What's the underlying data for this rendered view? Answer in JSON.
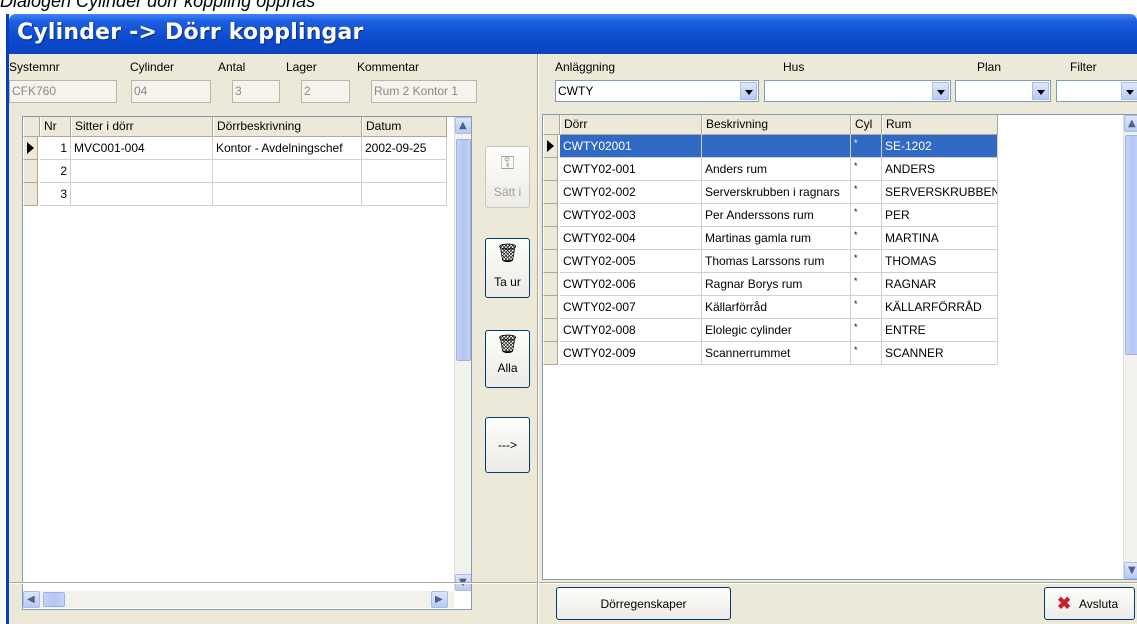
{
  "caption": "Dialogen Cylinder dörr koppling öppnas",
  "window": {
    "title": "Cylinder -> Dörr kopplingar"
  },
  "cylinder_info": {
    "labels": {
      "systemnr": "Systemnr",
      "cylinder": "Cylinder",
      "antal": "Antal",
      "lager": "Lager",
      "kommentar": "Kommentar"
    },
    "values": {
      "systemnr": "CFK760",
      "cylinder": "04",
      "antal": "3",
      "lager": "2",
      "kommentar": "Rum 2 Kontor 1"
    }
  },
  "left_grid": {
    "columns": [
      "Nr",
      "Sitter i dörr",
      "Dörrbeskrivning",
      "Datum"
    ],
    "rows": [
      {
        "nr": "1",
        "door": "MVC001-004",
        "desc": "Kontor  - Avdelningschef",
        "date": "2002-09-25"
      },
      {
        "nr": "2",
        "door": "",
        "desc": "",
        "date": ""
      },
      {
        "nr": "3",
        "door": "",
        "desc": "",
        "date": ""
      }
    ]
  },
  "actions": {
    "insert_label": "Sätt i",
    "remove_label": "Ta ur",
    "remove_all_label": "Alla",
    "transfer_label": "--->"
  },
  "filters": {
    "labels": {
      "anlaggning": "Anläggning",
      "hus": "Hus",
      "plan": "Plan",
      "filter": "Filter"
    },
    "values": {
      "anlaggning": "CWTY",
      "hus": "",
      "plan": "",
      "filter": ""
    }
  },
  "right_grid": {
    "columns": [
      "Dörr",
      "Beskrivning",
      "Cyl",
      "Rum"
    ],
    "rows": [
      {
        "door": "CWTY02001",
        "desc": "",
        "cyl": "*",
        "room": "SE-1202"
      },
      {
        "door": "CWTY02-001",
        "desc": "Anders rum",
        "cyl": "*",
        "room": "ANDERS"
      },
      {
        "door": "CWTY02-002",
        "desc": "Serverskrubben i ragnars",
        "cyl": "*",
        "room": "SERVERSKRUBBEN"
      },
      {
        "door": "CWTY02-003",
        "desc": "Per Anderssons rum",
        "cyl": "*",
        "room": "PER"
      },
      {
        "door": "CWTY02-004",
        "desc": "Martinas gamla rum",
        "cyl": "*",
        "room": "MARTINA"
      },
      {
        "door": "CWTY02-005",
        "desc": "Thomas Larssons rum",
        "cyl": "*",
        "room": "THOMAS"
      },
      {
        "door": "CWTY02-006",
        "desc": "Ragnar Borys rum",
        "cyl": "*",
        "room": "RAGNAR"
      },
      {
        "door": "CWTY02-007",
        "desc": "Källarförråd",
        "cyl": "*",
        "room": "KÄLLARFÖRRÅD"
      },
      {
        "door": "CWTY02-008",
        "desc": "Elolegic cylinder",
        "cyl": "*",
        "room": "ENTRE"
      },
      {
        "door": "CWTY02-009",
        "desc": "Scannerrummet",
        "cyl": "*",
        "room": "SCANNER"
      }
    ]
  },
  "footer": {
    "properties_label": "Dörregenskaper",
    "exit_label": "Avsluta"
  },
  "icons": {
    "insert": "insert-key-icon",
    "remove": "trash-icon",
    "remove_all": "trash-all-icon",
    "exit": "red-x-icon"
  },
  "colors": {
    "title_bar": "#0b4ccf",
    "selection": "#316ac5",
    "window_bg": "#ece9d8",
    "exit_icon": "#c8202a"
  }
}
